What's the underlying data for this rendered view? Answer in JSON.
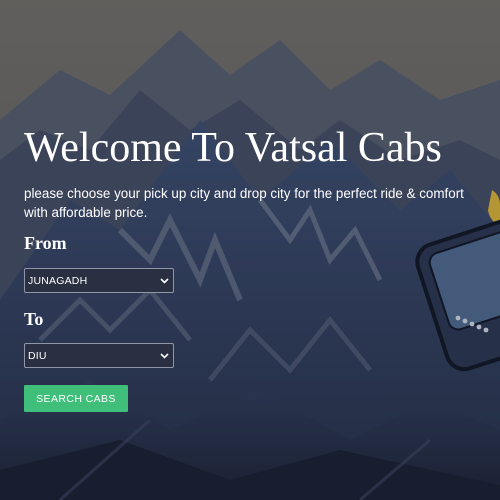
{
  "hero": {
    "title": "Welcome To Vatsal Cabs",
    "subtitle": "please choose your pick up city and drop city for the perfect ride & comfort with affordable price."
  },
  "form": {
    "from_label": "From",
    "from_value": "JUNAGADH",
    "to_label": "To",
    "to_value": "DIU",
    "search_label": "SEARCH CABS"
  },
  "icons": {
    "dropdown": "chevron-down-icon",
    "phone": "phone-illustration"
  },
  "colors": {
    "search_button": "#3fbf7a",
    "mountains": "#2d3b5c",
    "sky": "#6a6a66"
  }
}
